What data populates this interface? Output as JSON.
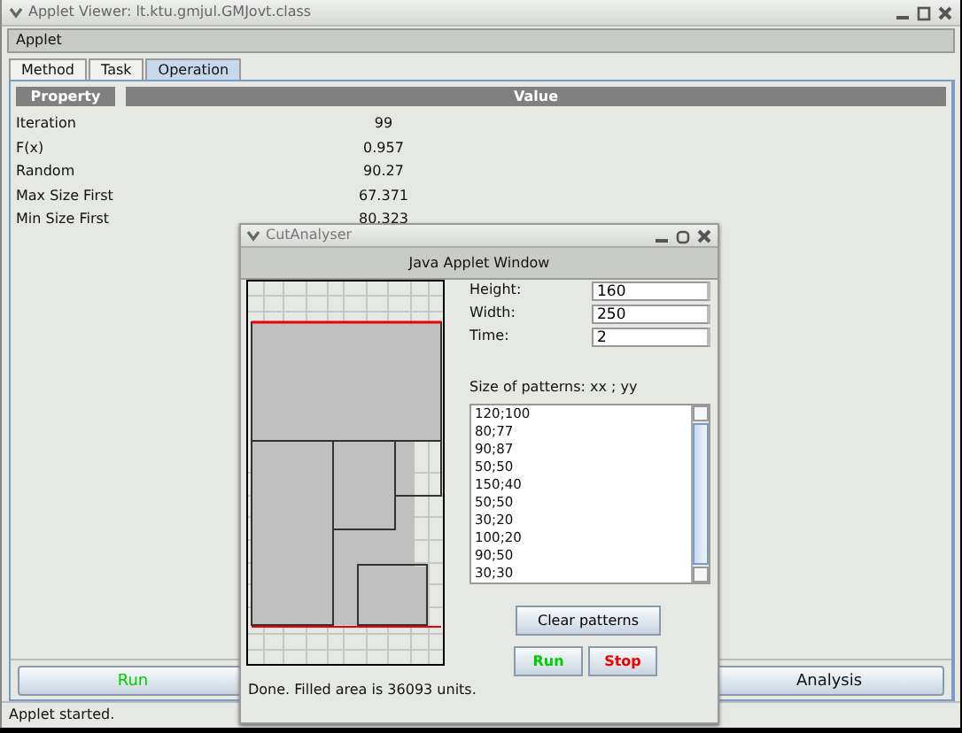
{
  "window": {
    "title": "Applet Viewer: lt.ktu.gmjul.GMJovt.class"
  },
  "menu": [
    "Applet"
  ],
  "tabs": [
    {
      "label": "Method",
      "selected": false
    },
    {
      "label": "Task",
      "selected": false
    },
    {
      "label": "Operation",
      "selected": true
    }
  ],
  "table": {
    "columns": [
      "Property",
      "Value"
    ],
    "rows": [
      {
        "property": "Iteration",
        "value": "99"
      },
      {
        "property": "F(x)",
        "value": "0.957"
      },
      {
        "property": "Random",
        "value": "90.27"
      },
      {
        "property": "Max Size First",
        "value": "67.371"
      },
      {
        "property": "Min Size First",
        "value": "80.323"
      }
    ]
  },
  "dialog": {
    "title": "CutAnalyser",
    "header": "Java Applet Window",
    "fields": [
      {
        "label": "Height:",
        "value": "160"
      },
      {
        "label": "Width:",
        "value": "250"
      },
      {
        "label": "Time:",
        "value": "2"
      }
    ],
    "patterns_label": "Size of patterns: xx ; yy",
    "patterns": [
      "120;100",
      "80;77",
      "90;87",
      "50;50",
      "150;40",
      "50;50",
      "30;20",
      "100;20",
      "90;50",
      "30;30"
    ],
    "clear_button": "Clear patterns",
    "buttons": [
      {
        "label": "Run",
        "kind": "start"
      },
      {
        "label": "Stop",
        "kind": "stop"
      }
    ],
    "status": "Done. Filled area is 36093 units."
  },
  "buttons": [
    {
      "label": "Run",
      "kind": "start"
    },
    {
      "label": "Analysis",
      "kind": "plain"
    }
  ],
  "status_bar": "Applet started."
}
